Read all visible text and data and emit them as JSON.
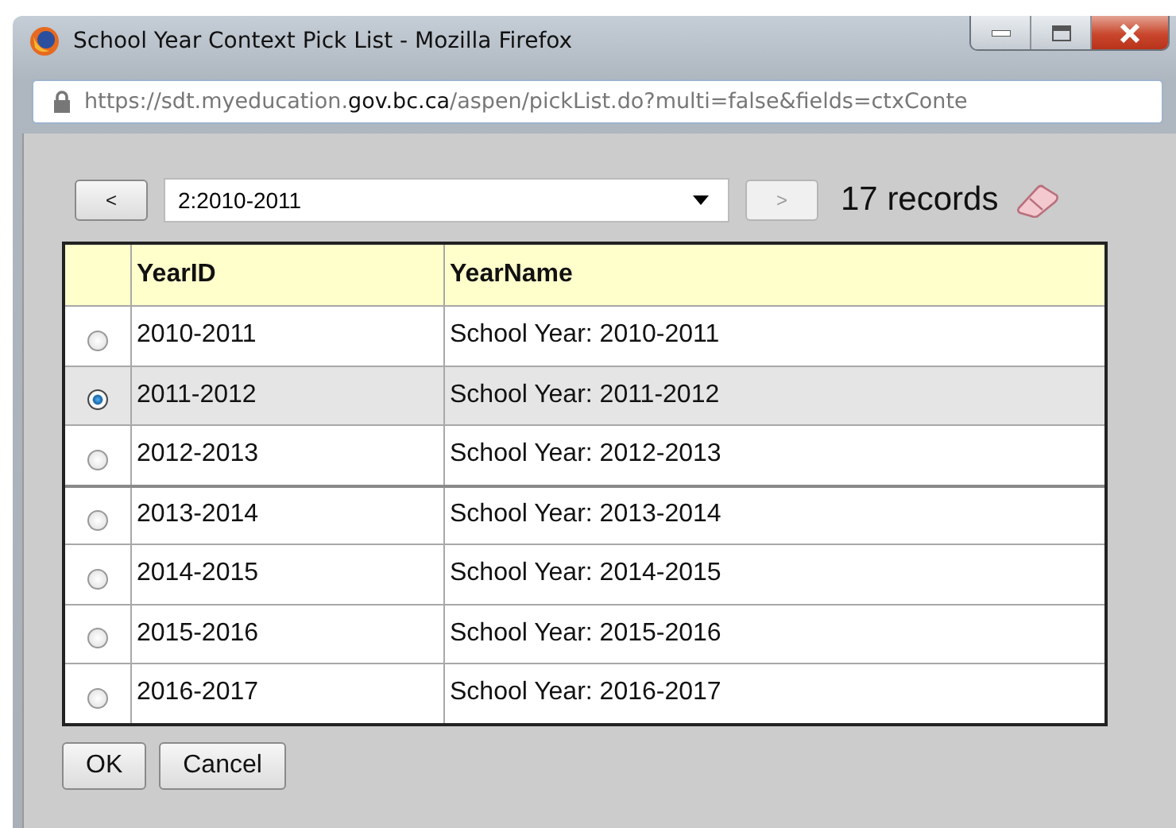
{
  "window": {
    "title": "School Year Context Pick List - Mozilla Firefox"
  },
  "address_bar": {
    "url_start": "https://sdt.myeducation.",
    "url_domain": "gov.bc.ca",
    "url_end": "/aspen/pickList.do?multi=false&fields=ctxConte"
  },
  "pager": {
    "prev": "<",
    "selection": "2:2010-2011",
    "next": ">",
    "next_disabled": true,
    "count": "17 records"
  },
  "table": {
    "columns": [
      "YearID",
      "YearName"
    ],
    "rows": [
      {
        "id": "2010-2011",
        "name": "School Year: 2010-2011",
        "selected": false
      },
      {
        "id": "2011-2012",
        "name": "School Year: 2011-2012",
        "selected": true
      },
      {
        "id": "2012-2013",
        "name": "School Year: 2012-2013",
        "selected": false
      },
      {
        "id": "2013-2014",
        "name": "School Year: 2013-2014",
        "selected": false
      },
      {
        "id": "2014-2015",
        "name": "School Year: 2014-2015",
        "selected": false
      },
      {
        "id": "2015-2016",
        "name": "School Year: 2015-2016",
        "selected": false
      },
      {
        "id": "2016-2017",
        "name": "School Year: 2016-2017",
        "selected": false
      }
    ]
  },
  "buttons": [
    "OK",
    "Cancel"
  ]
}
